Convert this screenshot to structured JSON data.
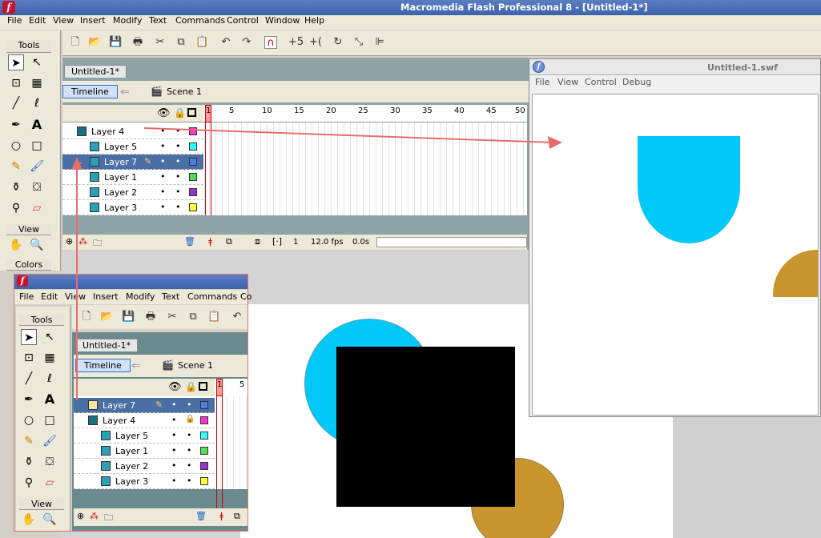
{
  "main_window": {
    "title": "Macromedia Flash Professional 8 - [Untitled-1*]",
    "menu": [
      "File",
      "Edit",
      "View",
      "Insert",
      "Modify",
      "Text",
      "Commands",
      "Control",
      "Window",
      "Help"
    ]
  },
  "tools": {
    "header": "Tools",
    "view_header": "View",
    "colors_header": "Colors"
  },
  "document": {
    "tab": "Untitled-1*",
    "timeline_button": "Timeline",
    "scene_label": "Scene 1",
    "ruler": [
      "1",
      "5",
      "10",
      "15",
      "20",
      "25",
      "30",
      "35",
      "40",
      "45",
      "50"
    ],
    "layers": [
      {
        "name": "Layer 4",
        "color": "#ff33cc",
        "selected": false
      },
      {
        "name": "Layer 5",
        "color": "#33ffff",
        "selected": false
      },
      {
        "name": "Layer 7",
        "color": "#4a7de0",
        "selected": true
      },
      {
        "name": "Layer 1",
        "color": "#55dd55",
        "selected": false
      },
      {
        "name": "Layer 2",
        "color": "#9933cc",
        "selected": false
      },
      {
        "name": "Layer 3",
        "color": "#ffff33",
        "selected": false
      }
    ],
    "status": {
      "frame": "1",
      "fps": "12.0 fps",
      "time": "0.0s"
    }
  },
  "swf_window": {
    "title": "Untitled-1.swf",
    "menu": [
      "File",
      "View",
      "Control",
      "Debug"
    ]
  },
  "overlay_window": {
    "menu": [
      "File",
      "Edit",
      "View",
      "Insert",
      "Modify",
      "Text",
      "Commands",
      "Co"
    ],
    "tools_header": "Tools",
    "view_header": "View",
    "tab": "Untitled-1*",
    "timeline_button": "Timeline",
    "scene_label": "Scene 1",
    "ruler": [
      "1",
      "5"
    ],
    "layers": [
      {
        "name": "Layer 7",
        "color": "#4a7de0",
        "selected": true
      },
      {
        "name": "Layer 4",
        "color": "#ff33cc",
        "selected": false
      },
      {
        "name": "Layer 5",
        "color": "#33ffff",
        "selected": false
      },
      {
        "name": "Layer 1",
        "color": "#55dd55",
        "selected": false
      },
      {
        "name": "Layer 2",
        "color": "#9933cc",
        "selected": false
      },
      {
        "name": "Layer 3",
        "color": "#ffff33",
        "selected": false
      }
    ]
  },
  "colors": {
    "cyan_circle": "#00c8f8",
    "orange_circle": "#c9952f",
    "black_square": "#000000",
    "annotation_arrow": "#e76d6d"
  }
}
